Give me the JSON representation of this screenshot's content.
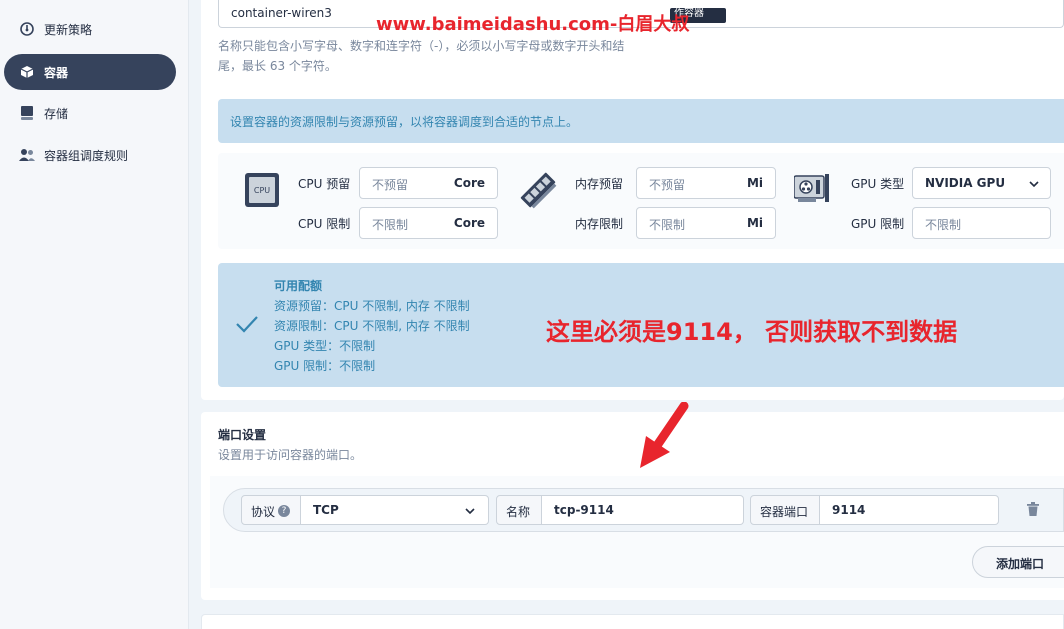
{
  "sidebar": {
    "items": [
      {
        "label": "更新策略",
        "icon": "dashboard-icon",
        "active": false
      },
      {
        "label": "容器",
        "icon": "container-icon",
        "active": true
      },
      {
        "label": "存储",
        "icon": "storage-icon",
        "active": false
      },
      {
        "label": "容器组调度规则",
        "icon": "users-icon",
        "active": false
      }
    ]
  },
  "container_name": {
    "value": "container-wiren3",
    "hint": "名称只能包含小写字母、数字和连字符（-），必须以小写字母或数字开头和结尾，最长 63 个字符。"
  },
  "resources": {
    "banner": "设置容器的资源限制与资源预留，以将容器调度到合适的节点上。",
    "cpu_icon_text": "CPU",
    "cpu_reserve_label": "CPU 预留",
    "cpu_reserve_placeholder": "不预留",
    "cpu_limit_label": "CPU 限制",
    "cpu_limit_placeholder": "不限制",
    "cpu_unit": "Core",
    "mem_reserve_label": "内存预留",
    "mem_reserve_placeholder": "不预留",
    "mem_limit_label": "内存限制",
    "mem_limit_placeholder": "不限制",
    "mem_unit": "Mi",
    "gpu_type_label": "GPU 类型",
    "gpu_type_value": "NVIDIA GPU",
    "gpu_limit_label": "GPU 限制",
    "gpu_limit_placeholder": "不限制"
  },
  "quota": {
    "title": "可用配额",
    "lines": [
      "资源预留：CPU 不限制, 内存 不限制",
      "资源限制：CPU 不限制, 内存 不限制",
      "GPU 类型：不限制",
      "GPU 限制：不限制"
    ]
  },
  "ports": {
    "title": "端口设置",
    "description": "设置用于访问容器的端口。",
    "protocol_label": "协议",
    "protocol_value": "TCP",
    "name_label": "名称",
    "name_value": "tcp-9114",
    "container_port_label": "容器端口",
    "container_port_value": "9114",
    "add_button": "添加端口"
  },
  "overlay": {
    "watermark": "www.baimeidashu.com-白眉大叔",
    "watermark_box": "作容器",
    "annotation": "这里必须是9114， 否则获取不到数据",
    "accent_color": "#e8252d"
  }
}
